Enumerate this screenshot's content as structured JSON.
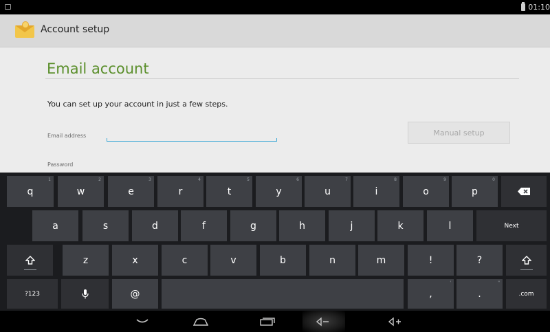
{
  "status_bar": {
    "time": "01:10",
    "left_icon": "screenshot-icon",
    "battery_icon": "battery-icon"
  },
  "action_bar": {
    "title": "Account setup",
    "app_icon": "email-envelope-icon"
  },
  "content": {
    "section_title": "Email account",
    "intro": "You can set up your account in just a few steps.",
    "email_label": "Email address",
    "email_value": "",
    "manual_setup_label": "Manual setup",
    "password_label": "Password"
  },
  "keyboard": {
    "row1": [
      {
        "k": "q",
        "h": "1"
      },
      {
        "k": "w",
        "h": "2"
      },
      {
        "k": "e",
        "h": "3"
      },
      {
        "k": "r",
        "h": "4"
      },
      {
        "k": "t",
        "h": "5"
      },
      {
        "k": "y",
        "h": "6"
      },
      {
        "k": "u",
        "h": "7"
      },
      {
        "k": "i",
        "h": "8"
      },
      {
        "k": "o",
        "h": "9"
      },
      {
        "k": "p",
        "h": "0"
      }
    ],
    "row2": [
      "a",
      "s",
      "d",
      "f",
      "g",
      "h",
      "j",
      "k",
      "l"
    ],
    "row3": [
      "z",
      "x",
      "c",
      "v",
      "b",
      "n",
      "m",
      "!",
      "?"
    ],
    "backspace_icon": "backspace-icon",
    "shift_icon": "shift-icon",
    "next_label": "Next",
    "symbols_label": "?123",
    "mic_icon": "microphone-icon",
    "at_label": "@",
    "comma_label": ",",
    "period_label": ".",
    "com_label": ".com",
    "row3_hint": "\"",
    "comma_hint": "'",
    "period_hint": "\""
  },
  "nav_bar": {
    "hide_keyboard_icon": "chevron-down-icon",
    "home_icon": "home-icon",
    "recents_icon": "recents-icon",
    "volume_down_icon": "volume-down-icon",
    "volume_up_icon": "volume-up-icon"
  }
}
